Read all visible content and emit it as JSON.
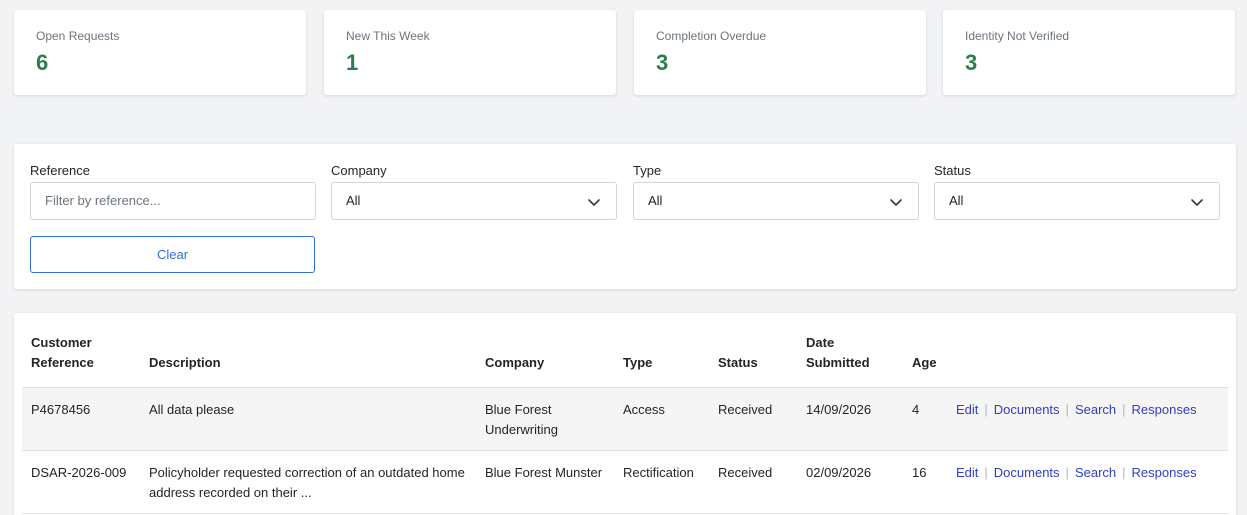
{
  "stats": [
    {
      "label": "Open Requests",
      "value": "6"
    },
    {
      "label": "New This Week",
      "value": "1"
    },
    {
      "label": "Completion Overdue",
      "value": "3"
    },
    {
      "label": "Identity Not Verified",
      "value": "3"
    }
  ],
  "filters": {
    "reference_label": "Reference",
    "reference_placeholder": "Filter by reference...",
    "reference_value": "",
    "company_label": "Company",
    "company_value": "All",
    "type_label": "Type",
    "type_value": "All",
    "status_label": "Status",
    "status_value": "All",
    "clear_label": "Clear"
  },
  "table": {
    "headers": {
      "ref_line1": "Customer",
      "ref_line2": "Reference",
      "description": "Description",
      "company": "Company",
      "type": "Type",
      "status": "Status",
      "date_line1": "Date",
      "date_line2": "Submitted",
      "age": "Age"
    },
    "rows": [
      {
        "reference": "P4678456",
        "description": "All data please",
        "company": "Blue Forest Underwriting",
        "type": "Access",
        "status": "Received",
        "date": "14/09/2026",
        "age": "4"
      },
      {
        "reference": "DSAR-2026-009",
        "description": "Policyholder requested correction of an outdated home address recorded on their ...",
        "company": "Blue Forest Munster",
        "type": "Rectification",
        "status": "Received",
        "date": "02/09/2026",
        "age": "16"
      }
    ],
    "actions": {
      "edit": "Edit",
      "documents": "Documents",
      "search": "Search",
      "responses": "Responses",
      "separator": "|"
    }
  },
  "colors": {
    "accent_green": "#2e7d4f",
    "link_blue": "#2f3ec4",
    "button_blue": "#2f6fdb"
  },
  "icons": {
    "select_arrow": "chevron-down-icon"
  }
}
